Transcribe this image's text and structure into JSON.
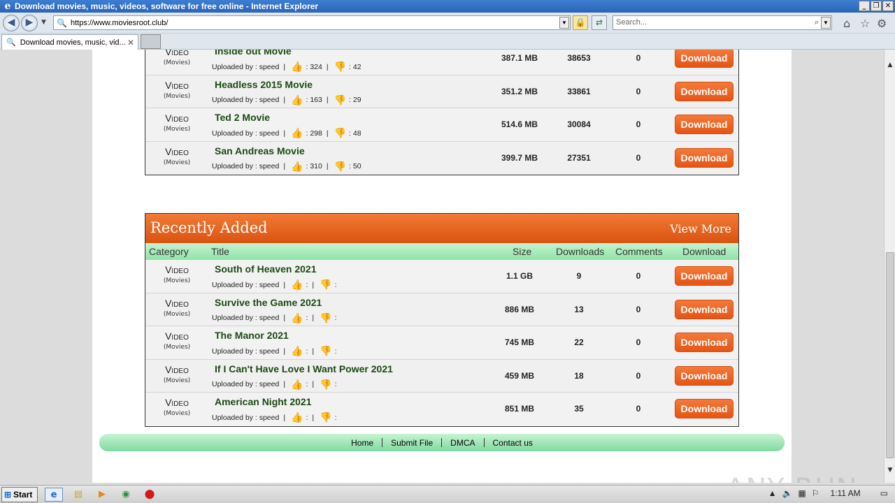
{
  "window": {
    "title": "Download movies, music, videos, software for free online - Internet Explorer",
    "controls": [
      "_",
      "❐",
      "✕"
    ]
  },
  "browser": {
    "url": "https://www.moviesroot.club/",
    "search_placeholder": "Search...",
    "tab_title": "Download movies, music, vid..."
  },
  "top_list": [
    {
      "cat": "Video",
      "sub": "(Movies)",
      "title": "Inside out Movie",
      "uploader": "Uploaded by : speed",
      "likes": ": 324",
      "dislikes": ": 42",
      "size": "387.1 MB",
      "downloads": "38653",
      "comments": "0"
    },
    {
      "cat": "Video",
      "sub": "(Movies)",
      "title": "Headless 2015 Movie",
      "uploader": "Uploaded by : speed",
      "likes": ": 163",
      "dislikes": ": 29",
      "size": "351.2 MB",
      "downloads": "33861",
      "comments": "0"
    },
    {
      "cat": "Video",
      "sub": "(Movies)",
      "title": "Ted 2 Movie",
      "uploader": "Uploaded by : speed",
      "likes": ": 298",
      "dislikes": ": 48",
      "size": "514.6 MB",
      "downloads": "30084",
      "comments": "0"
    },
    {
      "cat": "Video",
      "sub": "(Movies)",
      "title": "San Andreas Movie",
      "uploader": "Uploaded by : speed",
      "likes": ": 310",
      "dislikes": ": 50",
      "size": "399.7 MB",
      "downloads": "27351",
      "comments": "0"
    }
  ],
  "recent": {
    "heading": "Recently Added",
    "view_more": "View More",
    "columns": {
      "category": "Category",
      "title": "Title",
      "size": "Size",
      "downloads": "Downloads",
      "comments": "Comments",
      "download": "Download"
    },
    "rows": [
      {
        "cat": "Video",
        "sub": "(Movies)",
        "title": "South of Heaven 2021",
        "uploader": "Uploaded by : speed",
        "likes": ":",
        "dislikes": ":",
        "size": "1.1 GB",
        "downloads": "9",
        "comments": "0"
      },
      {
        "cat": "Video",
        "sub": "(Movies)",
        "title": "Survive the Game 2021",
        "uploader": "Uploaded by : speed",
        "likes": ":",
        "dislikes": ":",
        "size": "886 MB",
        "downloads": "13",
        "comments": "0"
      },
      {
        "cat": "Video",
        "sub": "(Movies)",
        "title": "The Manor 2021",
        "uploader": "Uploaded by : speed",
        "likes": ":",
        "dislikes": ":",
        "size": "745 MB",
        "downloads": "22",
        "comments": "0"
      },
      {
        "cat": "Video",
        "sub": "(Movies)",
        "title": "If I Can't Have Love I Want Power 2021",
        "uploader": "Uploaded by : speed",
        "likes": ":",
        "dislikes": ":",
        "size": "459 MB",
        "downloads": "18",
        "comments": "0"
      },
      {
        "cat": "Video",
        "sub": "(Movies)",
        "title": "American Night 2021",
        "uploader": "Uploaded by : speed",
        "likes": ":",
        "dislikes": ":",
        "size": "851 MB",
        "downloads": "35",
        "comments": "0"
      }
    ]
  },
  "download_label": "Download",
  "footer": {
    "home": "Home",
    "submit": "Submit File",
    "dmca": "DMCA",
    "contact": "Contact us"
  },
  "watermark": "ANY RUN",
  "taskbar": {
    "start": "Start",
    "clock": "1:11 AM"
  },
  "colors": {
    "accent_orange": "#e55514",
    "title_green": "#1b4a13",
    "footer_green": "#80d99e"
  }
}
